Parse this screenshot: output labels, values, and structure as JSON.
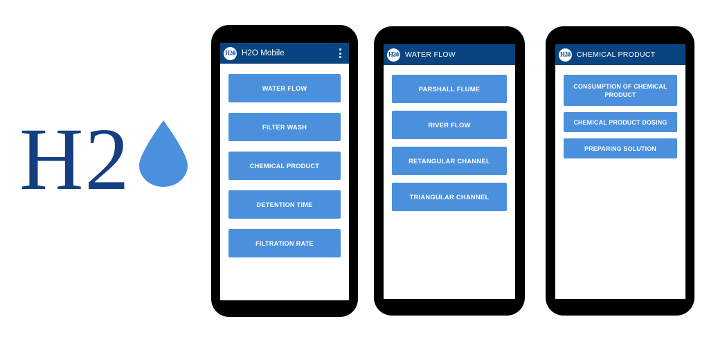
{
  "brand": {
    "text": "H2",
    "droplet_icon": "water-droplet-icon",
    "text_color": "#143f81",
    "droplet_color": "#4a90dd",
    "full_name": "H2O"
  },
  "colors": {
    "app_bar": "#0a4480",
    "button": "#4a90dd",
    "button_text": "#ffffff",
    "phone_frame": "#000000",
    "screen_background": "#ffffff"
  },
  "phones": [
    {
      "id": "phone-1",
      "app_bar": {
        "logo_icon": "h2o-logo-icon",
        "title": "H2O Mobile",
        "has_overflow_menu": true,
        "overflow_icon": "overflow-menu-icon"
      },
      "buttons": [
        {
          "label": "WATER FLOW"
        },
        {
          "label": "FILTER WASH"
        },
        {
          "label": "CHEMICAL PRODUCT"
        },
        {
          "label": "DETENTION TIME"
        },
        {
          "label": "FILTRATION RATE"
        }
      ]
    },
    {
      "id": "phone-2",
      "app_bar": {
        "logo_icon": "h2o-logo-icon",
        "title": "WATER FLOW",
        "has_overflow_menu": false,
        "overflow_icon": ""
      },
      "buttons": [
        {
          "label": "PARSHALL FLUME"
        },
        {
          "label": "RIVER FLOW"
        },
        {
          "label": "RETANGULAR CHANNEL"
        },
        {
          "label": "TRIANGULAR CHANNEL"
        }
      ]
    },
    {
      "id": "phone-3",
      "app_bar": {
        "logo_icon": "h2o-logo-icon",
        "title": "CHEMICAL PRODUCT",
        "has_overflow_menu": false,
        "overflow_icon": ""
      },
      "buttons": [
        {
          "label": "CONSUMPTION OF CHEMICAL PRODUCT"
        },
        {
          "label": "CHEMICAL PRODUCT DOSING"
        },
        {
          "label": "PREPARING SOLUTION"
        }
      ]
    }
  ]
}
